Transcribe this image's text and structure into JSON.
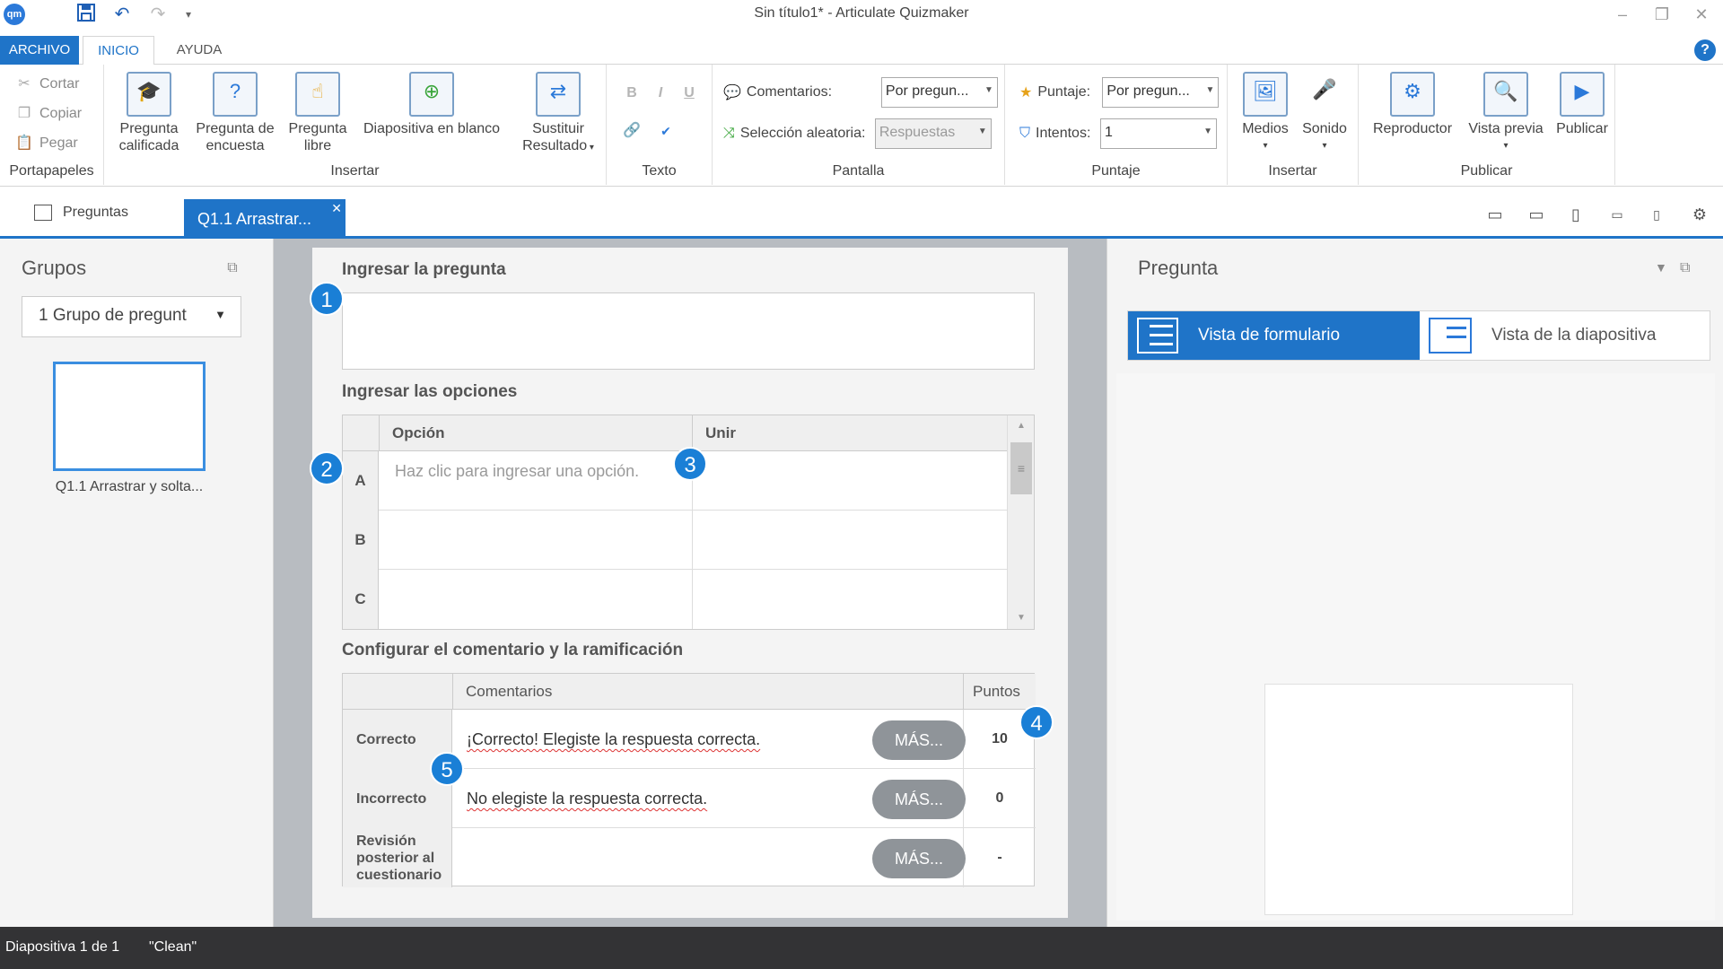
{
  "window": {
    "title": "Sin título1* - Articulate Quizmaker",
    "logo": "qm"
  },
  "ribbon_tabs": [
    "ARCHIVO",
    "INICIO",
    "AYUDA"
  ],
  "ribbon": {
    "clipboard": {
      "cut": "Cortar",
      "copy": "Copiar",
      "paste": "Pegar",
      "label": "Portapapeles"
    },
    "insert": {
      "graded_line1": "Pregunta",
      "graded_line2": "calificada",
      "survey_line1": "Pregunta de",
      "survey_line2": "encuesta",
      "free_line1": "Pregunta",
      "free_line2": "libre",
      "blank_slide": "Diapositiva en blanco",
      "replace_line1": "Sustituir",
      "replace_line2": "Resultado",
      "label": "Insertar"
    },
    "text": {
      "bold": "B",
      "italic": "I",
      "underline": "U",
      "label": "Texto"
    },
    "display": {
      "feedback_label": "Comentarios:",
      "feedback_value": "Por pregun...",
      "shuffle_label": "Selección aleatoria:",
      "shuffle_value": "Respuestas",
      "label": "Pantalla"
    },
    "scoring": {
      "points_label": "Puntaje:",
      "points_value": "Por pregun...",
      "attempts_label": "Intentos:",
      "attempts_value": "1",
      "label": "Puntaje"
    },
    "media": {
      "media": "Medios",
      "sound": "Sonido",
      "label": "Insertar"
    },
    "publish": {
      "player": "Reproductor",
      "preview": "Vista previa",
      "publish": "Publicar",
      "label": "Publicar"
    }
  },
  "doc_tabs": {
    "questions": "Preguntas",
    "active": "Q1.1 Arrastrar..."
  },
  "left_panel": {
    "title": "Grupos",
    "group_select": "1 Grupo de pregunt",
    "slide_label": "Q1.1 Arrastrar y solta..."
  },
  "form": {
    "question_title": "Ingresar la pregunta",
    "question_value": "",
    "options_title": "Ingresar las opciones",
    "col_option": "Opción",
    "col_match": "Unir",
    "options": [
      {
        "letter": "A",
        "option": "Haz clic para ingresar una opción.",
        "match": ""
      },
      {
        "letter": "B",
        "option": "",
        "match": ""
      },
      {
        "letter": "C",
        "option": "",
        "match": ""
      }
    ],
    "feedback_title": "Configurar el comentario y la ramificación",
    "col_feedback": "Comentarios",
    "col_points": "Puntos",
    "feedback": [
      {
        "label": "Correcto",
        "text": "¡Correcto!  Elegiste la respuesta correcta.",
        "more": "MÁS...",
        "points": "10"
      },
      {
        "label": "Incorrecto",
        "text": "No elegiste la respuesta correcta.",
        "more": "MÁS...",
        "points": "0"
      },
      {
        "label": "Revisión posterior al cuestionario",
        "text": "",
        "more": "MÁS...",
        "points": "-"
      }
    ],
    "badges": [
      "1",
      "2",
      "3",
      "4",
      "5"
    ]
  },
  "right_panel": {
    "title": "Pregunta",
    "form_view": "Vista de formulario",
    "slide_view": "Vista de la diapositiva"
  },
  "status": {
    "slide": "Diapositiva 1 de 1",
    "theme": "\"Clean\""
  },
  "colors": {
    "accent": "#1f74c8",
    "badge": "#1a7fd6",
    "status_bar": "#333335"
  }
}
